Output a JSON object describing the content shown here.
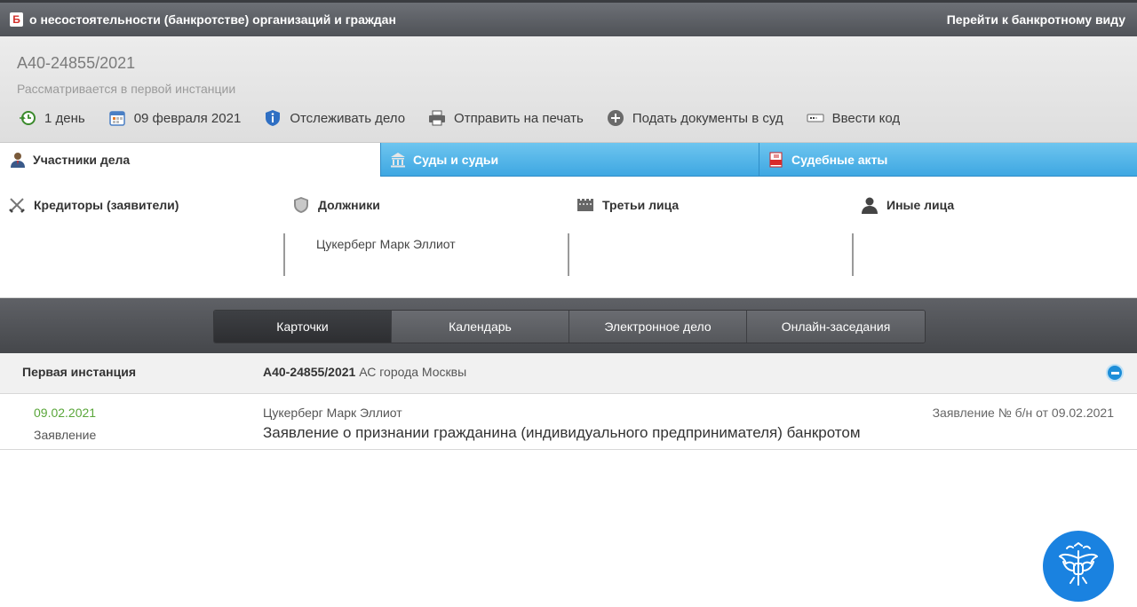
{
  "topbar": {
    "logo_letter": "Б",
    "title": "о несостоятельности (банкротстве) организаций и граждан",
    "link": "Перейти к банкротному виду"
  },
  "case": {
    "number": "А40-24855/2021",
    "status": "Рассматривается в первой инстанции"
  },
  "actions": [
    {
      "label": "1 день",
      "icon": "clock-arrow-icon"
    },
    {
      "label": "09 февраля 2021",
      "icon": "calendar-icon"
    },
    {
      "label": "Отслеживать дело",
      "icon": "shield-info-icon"
    },
    {
      "label": "Отправить на печать",
      "icon": "printer-icon"
    },
    {
      "label": "Подать документы в суд",
      "icon": "plus-circle-icon"
    },
    {
      "label": "Ввести код",
      "icon": "code-icon"
    }
  ],
  "tabs": [
    {
      "label": "Участники дела",
      "icon": "person-icon",
      "active": true
    },
    {
      "label": "Суды и судьи",
      "icon": "courthouse-icon",
      "active": false
    },
    {
      "label": "Судебные акты",
      "icon": "pdf-icon",
      "active": false
    }
  ],
  "participants": {
    "creditors": {
      "title": "Кредиторы (заявители)",
      "items": []
    },
    "debtors": {
      "title": "Должники",
      "items": [
        "Цукерберг Марк Эллиот"
      ]
    },
    "third": {
      "title": "Третьи лица",
      "items": []
    },
    "others": {
      "title": "Иные лица",
      "items": []
    }
  },
  "views": {
    "cards": "Карточки",
    "calendar": "Календарь",
    "electronic": "Электронное дело",
    "online": "Онлайн-заседания"
  },
  "instance": {
    "label": "Первая инстанция",
    "case_number": "А40-24855/2021",
    "court": "АС города Москвы"
  },
  "document": {
    "date": "09.02.2021",
    "kind": "Заявление",
    "author": "Цукерберг Марк Эллиот",
    "title": "Заявление о признании гражданина (индивидуального предпринимателя) банкротом",
    "ref": "Заявление № б/н от 09.02.2021"
  },
  "colors": {
    "tab_blue": "#3ea7e2",
    "date_green": "#5aa63a",
    "fab_blue": "#1a82e0"
  }
}
